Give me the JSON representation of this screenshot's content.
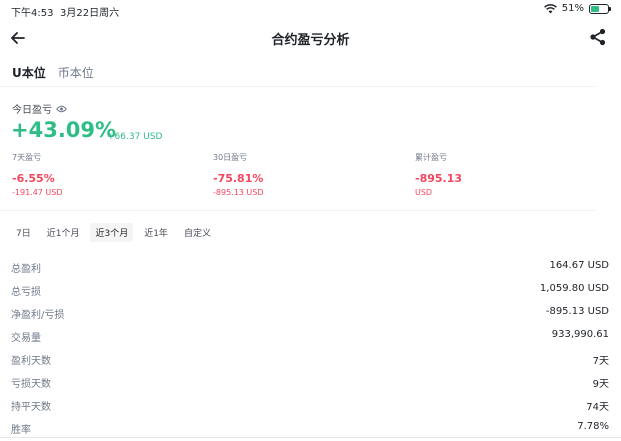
{
  "status": {
    "time": "下午4:53",
    "date": "3月22日周六",
    "battery": "51%",
    "battery_level": 0.51
  },
  "nav": {
    "title": "合约盈亏分析",
    "icons": [
      "arrow-left-icon",
      "share-icon"
    ]
  },
  "unit_tabs": [
    {
      "label": "U本位"
    },
    {
      "label": "币本位"
    }
  ],
  "today": {
    "label": "今日盈亏",
    "pct": "+43.09%",
    "usd": "+66.37 USD"
  },
  "stats": [
    {
      "label": "7天盈亏",
      "value": "-6.55%",
      "sub": "-191.47 USD"
    },
    {
      "label": "30日盈亏",
      "value": "-75.81%",
      "sub": "-895.13 USD"
    },
    {
      "label": "累计盈亏",
      "value": "-895.13",
      "sub": "USD"
    }
  ],
  "ranges": [
    {
      "label": "7日"
    },
    {
      "label": "近1个月"
    },
    {
      "label": "近3个月"
    },
    {
      "label": "近1年"
    },
    {
      "label": "自定义"
    }
  ],
  "rows": [
    {
      "key": "总盈利",
      "value": "164.67 USD"
    },
    {
      "key": "总亏损",
      "value": "1,059.80 USD"
    },
    {
      "key": "净盈利/亏损",
      "value": "-895.13 USD"
    },
    {
      "key": "交易量",
      "value": "933,990.61"
    },
    {
      "key": "盈利天数",
      "value": "7天"
    },
    {
      "key": "亏损天数",
      "value": "9天"
    },
    {
      "key": "持平天数",
      "value": "74天"
    },
    {
      "key": "胜率",
      "value": "7.78%"
    }
  ],
  "colors": {
    "up": "#2ebd85",
    "down": "#f6465d",
    "text": "#1e2329",
    "muted": "#707a8a"
  }
}
